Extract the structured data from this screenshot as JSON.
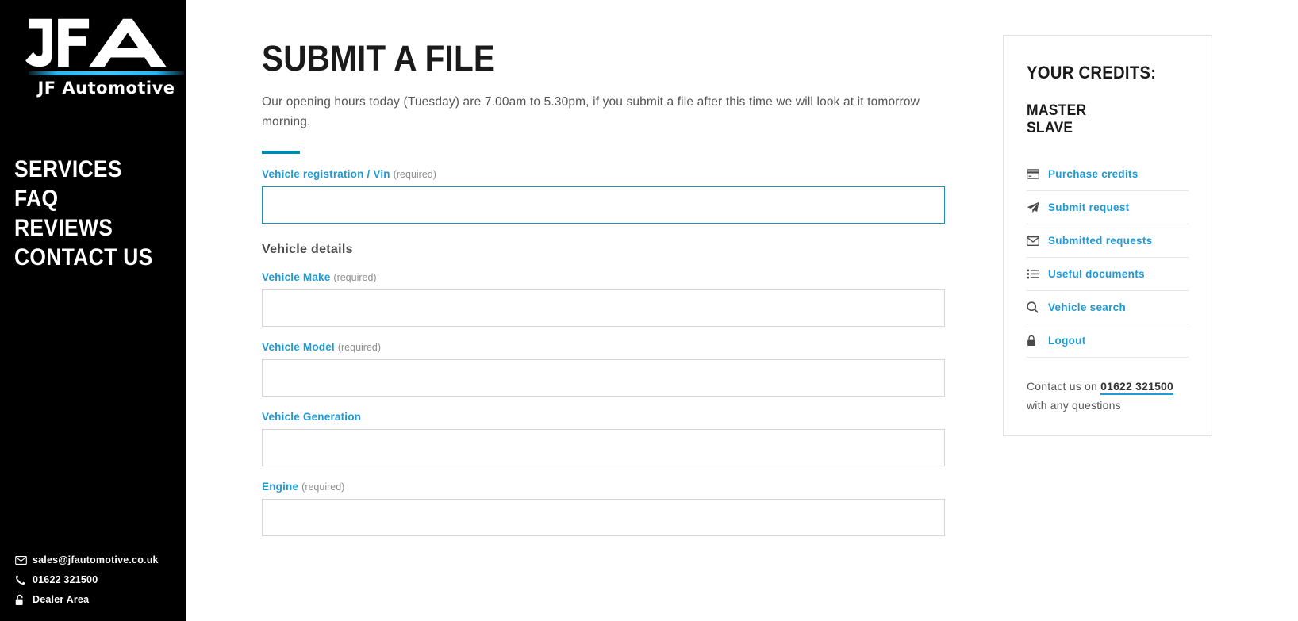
{
  "sidebar": {
    "logo": {
      "mark": "JFA",
      "wordmark": "JF Automotive"
    },
    "nav": [
      {
        "label": "SERVICES",
        "icon": "none"
      },
      {
        "label": "FAQ",
        "icon": "none"
      },
      {
        "label": "REVIEWS",
        "icon": "none"
      },
      {
        "label": "CONTACT US",
        "icon": "none"
      }
    ],
    "footer": [
      {
        "icon": "envelope-icon",
        "label": "sales@jfautomotive.co.uk"
      },
      {
        "icon": "phone-icon",
        "label": "01622 321500"
      },
      {
        "icon": "unlock-icon",
        "label": "Dealer Area"
      }
    ]
  },
  "main": {
    "title": "SUBMIT A FILE",
    "intro": "Our opening hours today (Tuesday) are 7.00am to 5.30pm, if you submit a file after this time we will look at it tomorrow morning.",
    "section_heading": "Vehicle details",
    "fields": [
      {
        "label": "Vehicle registration / Vin",
        "required_note": "(required)",
        "value": "",
        "placeholder": "",
        "focused": true
      },
      {
        "label": "Vehicle Make",
        "required_note": "(required)",
        "value": "",
        "placeholder": "",
        "focused": false
      },
      {
        "label": "Vehicle Model",
        "required_note": "(required)",
        "value": "",
        "placeholder": "",
        "focused": false
      },
      {
        "label": "Vehicle Generation",
        "required_note": "",
        "value": "",
        "placeholder": "",
        "focused": false
      },
      {
        "label": "Engine",
        "required_note": "(required)",
        "value": "",
        "placeholder": "",
        "focused": false
      }
    ]
  },
  "credits_panel": {
    "title": "YOUR CREDITS:",
    "credit_lines": [
      "MASTER",
      "SLAVE"
    ],
    "menu": [
      {
        "icon": "credit-card-icon",
        "label": "Purchase credits"
      },
      {
        "icon": "paper-plane-icon",
        "label": "Submit request"
      },
      {
        "icon": "envelope-icon",
        "label": "Submitted requests"
      },
      {
        "icon": "list-icon",
        "label": "Useful documents"
      },
      {
        "icon": "search-icon",
        "label": "Vehicle search"
      },
      {
        "icon": "lock-icon",
        "label": "Logout"
      }
    ],
    "contact": {
      "prefix": "Contact us on",
      "phone": "01622 321500",
      "suffix": "with any questions"
    }
  },
  "colors": {
    "accent_blue": "#1e9ad6",
    "accent_bar": "#0089ad",
    "sidebar_bg": "#000000",
    "logo_stripe": "#2ebdf3",
    "panel_border": "#e2e2e2",
    "input_border": "#d6d6d6",
    "input_focus_border": "#1e8fb8"
  }
}
